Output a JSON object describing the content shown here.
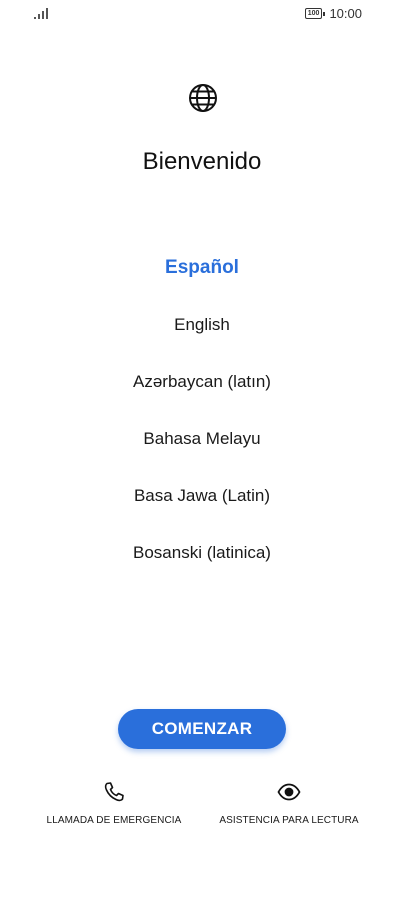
{
  "status_bar": {
    "time": "10:00",
    "battery": "100"
  },
  "welcome": {
    "title": "Bienvenido"
  },
  "languages": [
    {
      "label": "Español",
      "selected": true
    },
    {
      "label": "English",
      "selected": false
    },
    {
      "label": "Azərbaycan (latın)",
      "selected": false
    },
    {
      "label": "Bahasa Melayu",
      "selected": false
    },
    {
      "label": "Basa Jawa (Latin)",
      "selected": false
    },
    {
      "label": "Bosanski (latinica)",
      "selected": false
    }
  ],
  "actions": {
    "start_label": "COMENZAR",
    "emergency_label": "LLAMADA DE EMERGENCIA",
    "reading_label": "ASISTENCIA PARA LECTURA"
  },
  "colors": {
    "accent": "#2a6fdb"
  },
  "icons": {
    "globe": "globe-icon",
    "phone": "phone-icon",
    "eye": "eye-icon"
  }
}
